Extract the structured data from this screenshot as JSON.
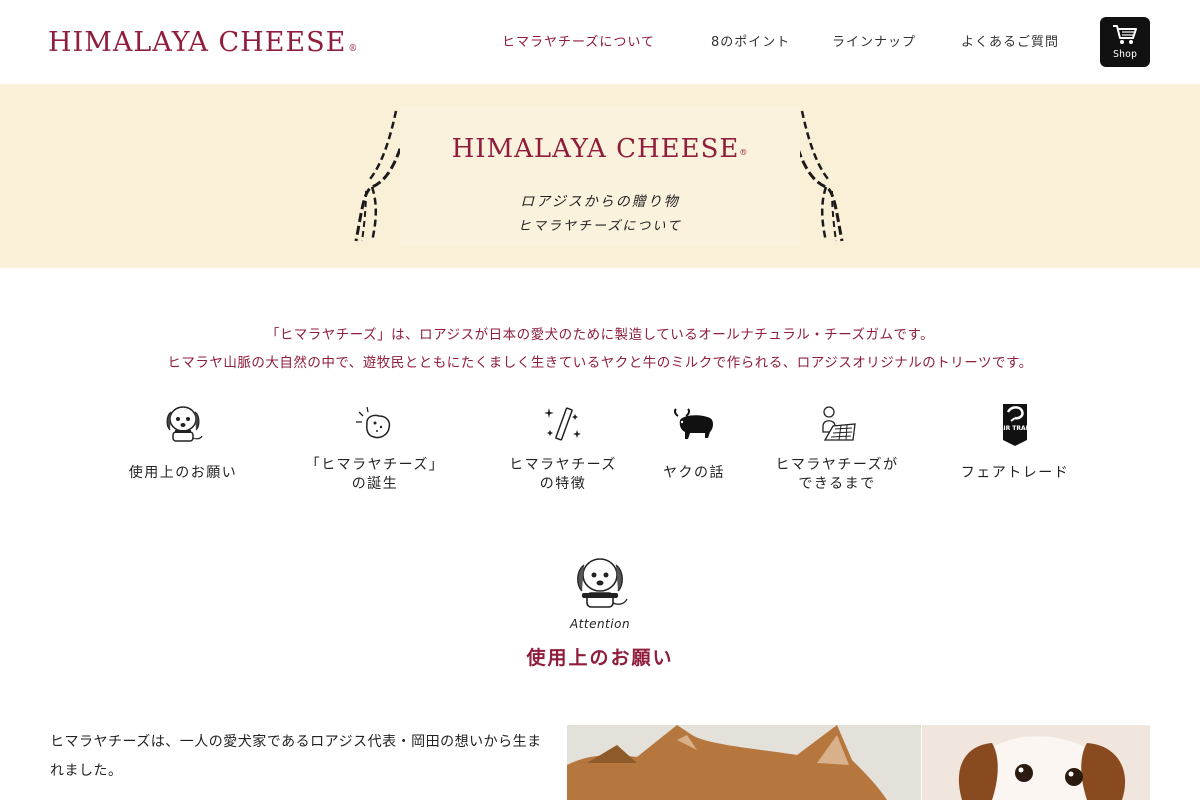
{
  "header": {
    "logo_text": "HIMALAYA CHEESE",
    "logo_mark": "®",
    "nav": [
      {
        "label": "ヒマラヤチーズについて",
        "active": true
      },
      {
        "label": "8のポイント",
        "active": false
      },
      {
        "label": "ラインナップ",
        "active": false
      },
      {
        "label": "よくあるご質問",
        "active": false
      }
    ],
    "shop": {
      "label": "Shop",
      "icon": "cart-icon"
    }
  },
  "banner": {
    "title": "HIMALAYA CHEESE",
    "title_mark": "®",
    "subtitle_line1": "ロアジスからの贈り物",
    "subtitle_line2": "ヒマラヤチーズについて"
  },
  "intro": {
    "line1": "「ヒマラヤチーズ」は、ロアジスが日本の愛犬のために製造しているオールナチュラル・チーズガムです。",
    "line2": "ヒマラヤ山脈の大自然の中で、遊牧民とともにたくましく生きているヤクと牛のミルクで作られる、ロアジスオリジナルのトリーツです。"
  },
  "features": [
    {
      "icon": "dog-icon",
      "lines": [
        "使用上のお願い"
      ]
    },
    {
      "icon": "cheese-icon",
      "lines": [
        "「ヒマラヤチーズ」",
        "の誕生"
      ]
    },
    {
      "icon": "sparkle-stick-icon",
      "lines": [
        "ヒマラヤチーズ",
        "の特徴"
      ]
    },
    {
      "icon": "yak-icon",
      "lines": [
        "ヤクの話"
      ]
    },
    {
      "icon": "worker-icon",
      "lines": [
        "ヒマラヤチーズが",
        "できるまで"
      ]
    },
    {
      "icon": "fair-trade-icon",
      "lines": [
        "フェアトレード"
      ],
      "badge_text": "FAIR TRADE"
    }
  ],
  "attention": {
    "sub": "Attention",
    "title": "使用上のお願い"
  },
  "body": {
    "paragraph": "ヒマラヤチーズは、一人の愛犬家であるロアジス代表・岡田の想いから生まれました。"
  },
  "colors": {
    "brand": "#8f1d3b",
    "banner_bg": "#faefd7"
  }
}
